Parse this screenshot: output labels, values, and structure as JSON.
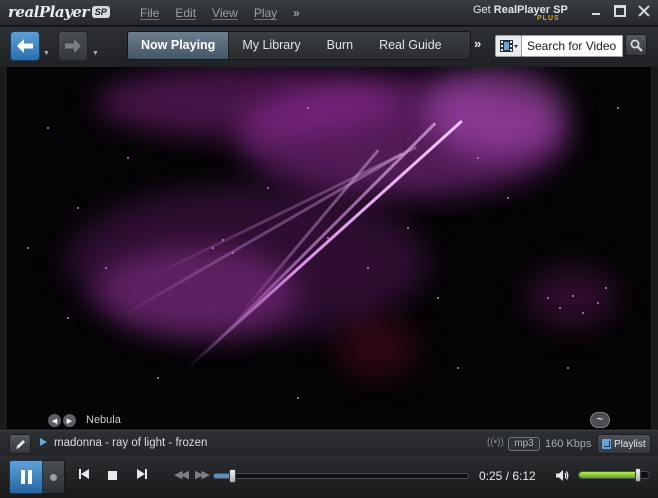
{
  "app": {
    "logo_text": "realPlayer",
    "logo_badge": "SP"
  },
  "menu": {
    "items": [
      "File",
      "Edit",
      "View",
      "Play"
    ],
    "more": "»"
  },
  "promo": {
    "prefix": "Get ",
    "product": "RealPlayer SP",
    "edition": "PLUS"
  },
  "tabs": [
    "Now Playing",
    "My Library",
    "Burn",
    "Real Guide"
  ],
  "tabs_more": "»",
  "search": {
    "placeholder": "Search for Video",
    "value": ""
  },
  "visualization": {
    "name": "Nebula",
    "prev": "◀",
    "next": "▶",
    "mode_symbol": "~"
  },
  "now_playing": {
    "title": "madonna - ray of light - frozen",
    "stream_symbol": "((•))",
    "format": "mp3",
    "bitrate": "160 Kbps",
    "playlist_label": "Playlist"
  },
  "playback": {
    "elapsed": "0:25",
    "separator": " / ",
    "duration": "6:12",
    "progress": 0.07,
    "volume": 0.84,
    "rewind_symbol": "◀◀",
    "forward_symbol": "▶▶"
  },
  "colors": {
    "accent": "#3d84c6",
    "volume": "#8fd23a",
    "visual": "#d98ee8"
  }
}
